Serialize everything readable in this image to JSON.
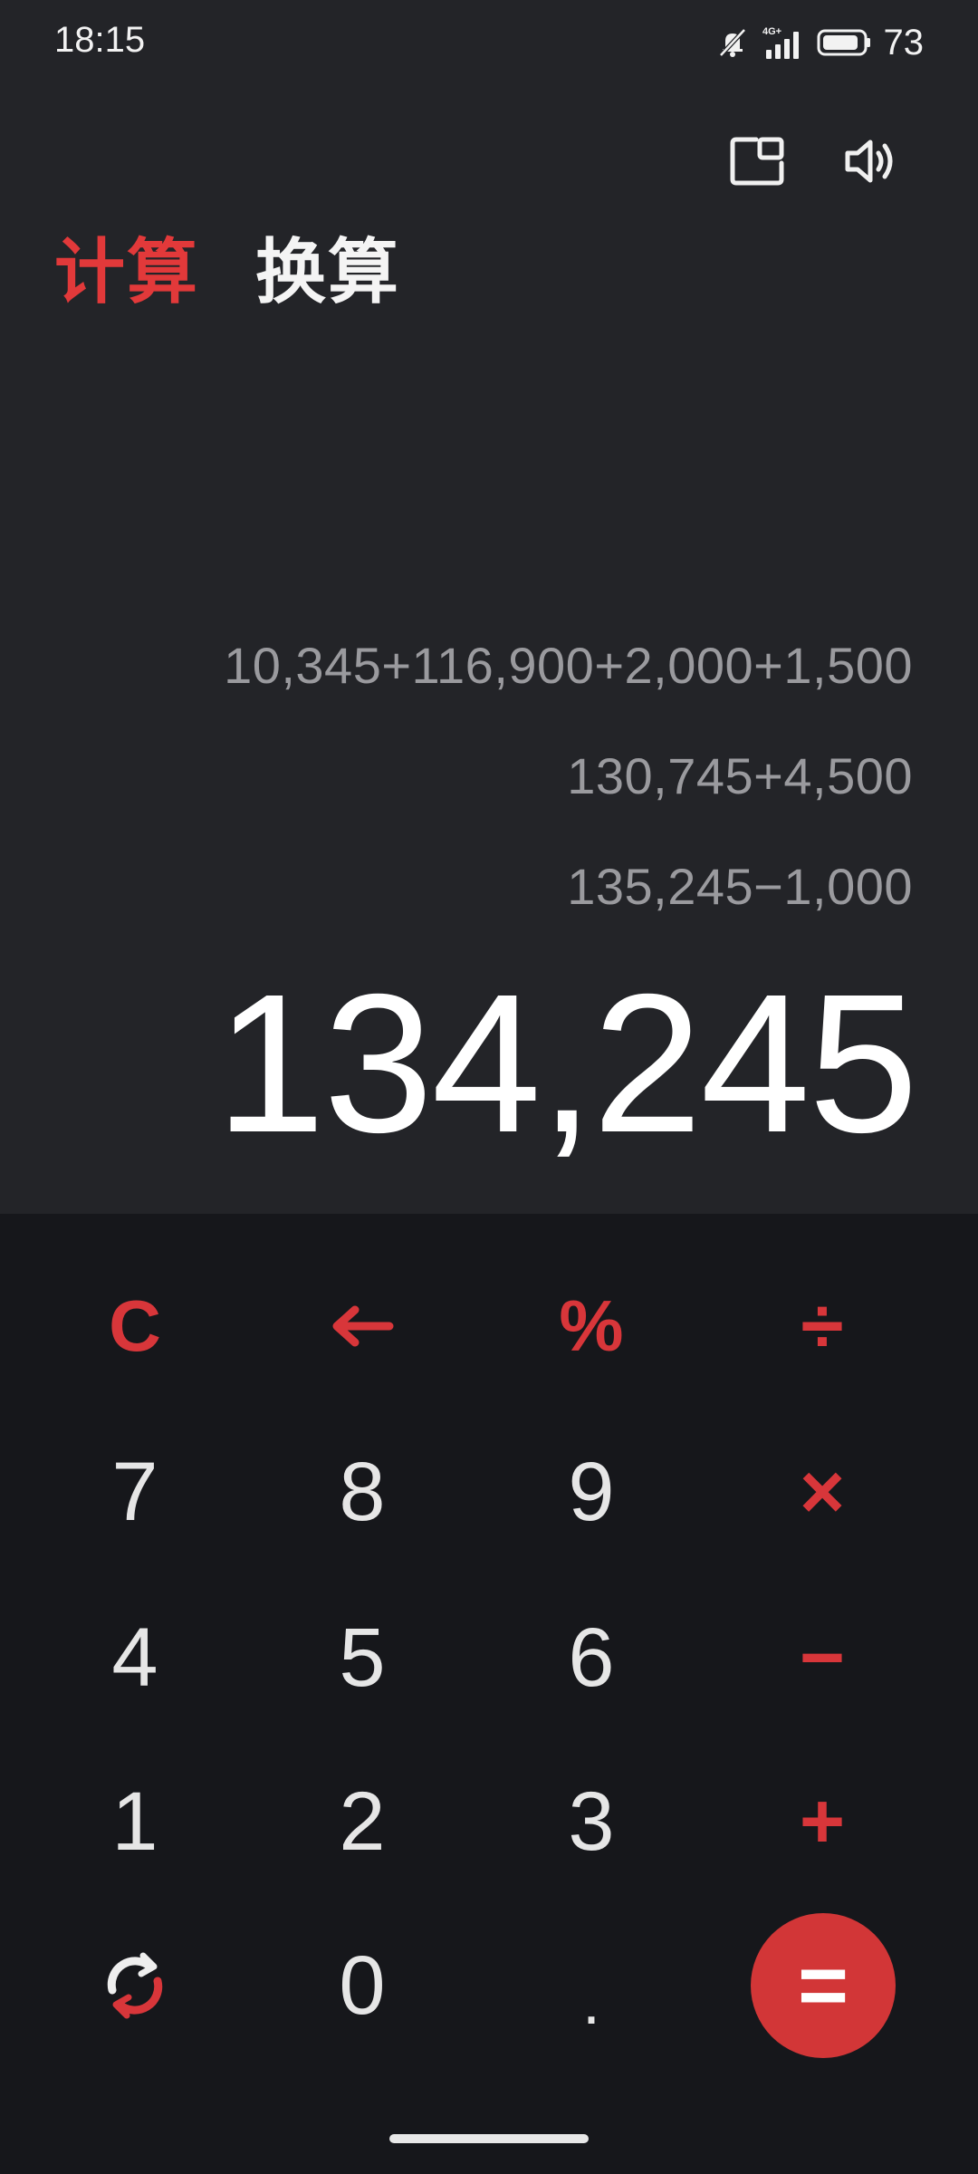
{
  "status_bar": {
    "time": "18:15",
    "network": "4G+",
    "battery": "73",
    "icons": [
      "muted-bell-icon",
      "signal-icon",
      "battery-icon"
    ]
  },
  "toolbar": {
    "icons": [
      "picture-in-picture-icon",
      "speaker-icon"
    ]
  },
  "tabs": [
    {
      "label": "计算",
      "active": true
    },
    {
      "label": "换算",
      "active": false
    }
  ],
  "history": [
    "10,345+116,900+2,000+1,500",
    "130,745+4,500",
    "135,245−1,000"
  ],
  "result": "134,245",
  "keypad": {
    "row1": [
      "C",
      "←",
      "%",
      "÷"
    ],
    "row2": [
      "7",
      "8",
      "9",
      "×"
    ],
    "row3": [
      "4",
      "5",
      "6",
      "−"
    ],
    "row4": [
      "1",
      "2",
      "3",
      "+"
    ],
    "row5": [
      "rotate-icon",
      "0",
      ".",
      "="
    ]
  },
  "colors": {
    "accent": "#d8363a",
    "display_bg": "#232428",
    "keypad_bg": "#16171b",
    "history_text": "#9a9a9e"
  }
}
